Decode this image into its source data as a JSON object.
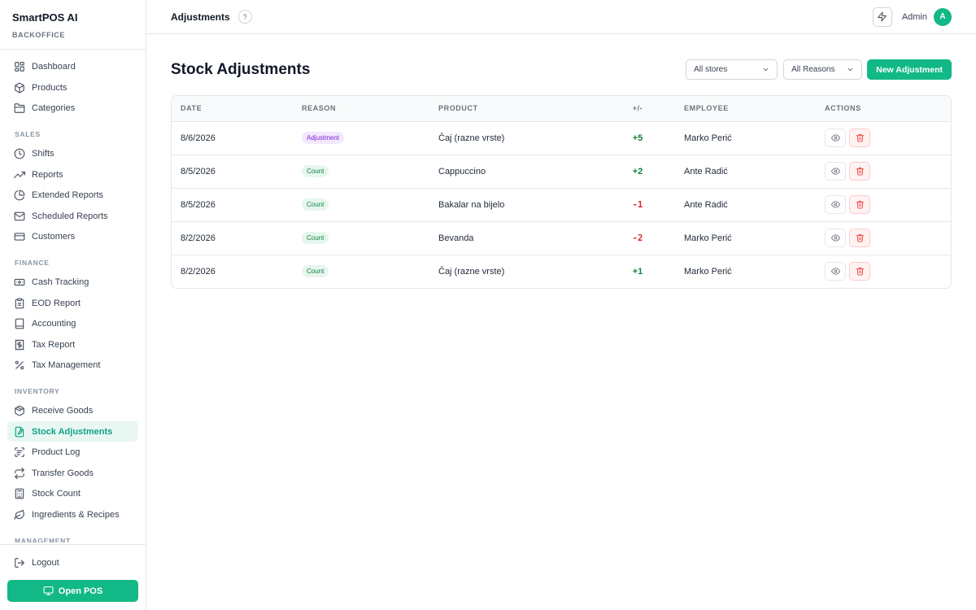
{
  "sidebar": {
    "brand_title": "SmartPOS AI",
    "brand_sub": "BACKOFFICE",
    "top_items": [
      {
        "label": "Dashboard",
        "icon": "dashboard-icon"
      },
      {
        "label": "Products",
        "icon": "box-icon"
      },
      {
        "label": "Categories",
        "icon": "folder-icon"
      }
    ],
    "sections": [
      {
        "title": "SALES",
        "items": [
          {
            "label": "Shifts",
            "icon": "clock-icon"
          },
          {
            "label": "Reports",
            "icon": "trending-icon"
          },
          {
            "label": "Extended Reports",
            "icon": "pie-chart-icon"
          },
          {
            "label": "Scheduled Reports",
            "icon": "mail-icon"
          },
          {
            "label": "Customers",
            "icon": "card-icon"
          }
        ]
      },
      {
        "title": "FINANCE",
        "items": [
          {
            "label": "Cash Tracking",
            "icon": "banknote-icon"
          },
          {
            "label": "EOD Report",
            "icon": "clipboard-icon"
          },
          {
            "label": "Accounting",
            "icon": "book-icon"
          },
          {
            "label": "Tax Report",
            "icon": "receipt-icon"
          },
          {
            "label": "Tax Management",
            "icon": "percent-icon"
          }
        ]
      },
      {
        "title": "INVENTORY",
        "items": [
          {
            "label": "Receive Goods",
            "icon": "package-icon"
          },
          {
            "label": "Stock Adjustments",
            "icon": "file-edit-icon",
            "active": true
          },
          {
            "label": "Product Log",
            "icon": "scan-icon"
          },
          {
            "label": "Transfer Goods",
            "icon": "arrows-icon"
          },
          {
            "label": "Stock Count",
            "icon": "calculator-icon"
          },
          {
            "label": "Ingredients & Recipes",
            "icon": "leaf-icon"
          }
        ]
      },
      {
        "title": "MANAGEMENT",
        "items": []
      }
    ],
    "logout_label": "Logout",
    "open_pos_label": "Open POS"
  },
  "topbar": {
    "title": "Adjustments",
    "help_glyph": "?",
    "user_name": "Admin",
    "avatar_letter": "A"
  },
  "main": {
    "page_title": "Stock Adjustments",
    "store_filter": "All stores",
    "reason_filter": "All Reasons",
    "new_button": "New Adjustment"
  },
  "table": {
    "columns": [
      "DATE",
      "REASON",
      "PRODUCT",
      "+/-",
      "EMPLOYEE",
      "ACTIONS"
    ],
    "rows": [
      {
        "date": "8/6/2026",
        "reason": "Adjustment",
        "reason_type": "adjustment",
        "product": "Čaj (razne vrste)",
        "delta": "+5",
        "sign": "pos",
        "employee": "Marko Perić"
      },
      {
        "date": "8/5/2026",
        "reason": "Count",
        "reason_type": "count",
        "product": "Cappuccino",
        "delta": "+2",
        "sign": "pos",
        "employee": "Ante Radić"
      },
      {
        "date": "8/5/2026",
        "reason": "Count",
        "reason_type": "count",
        "product": "Bakalar na bijelo",
        "delta": "-1",
        "sign": "neg",
        "employee": "Ante Radić"
      },
      {
        "date": "8/2/2026",
        "reason": "Count",
        "reason_type": "count",
        "product": "Bevanda",
        "delta": "-2",
        "sign": "neg",
        "employee": "Marko Perić"
      },
      {
        "date": "8/2/2026",
        "reason": "Count",
        "reason_type": "count",
        "product": "Čaj (razne vrste)",
        "delta": "+1",
        "sign": "pos",
        "employee": "Marko Perić"
      }
    ]
  },
  "colors": {
    "accent": "#12b886",
    "active_bg": "#e9f7f3",
    "positive": "#15803d",
    "negative": "#dc2626"
  }
}
